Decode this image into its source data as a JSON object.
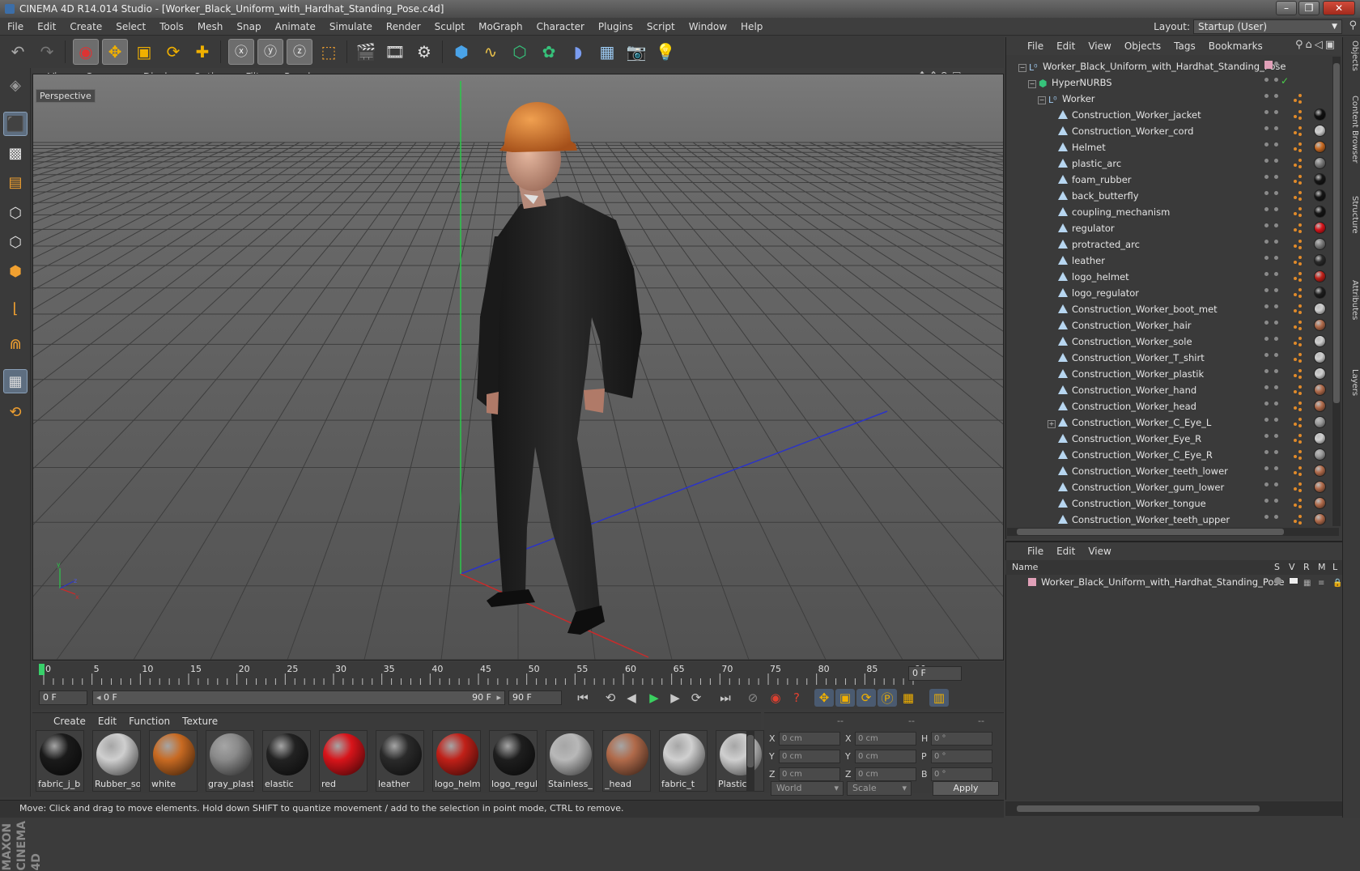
{
  "window": {
    "title": "CINEMA 4D R14.014 Studio - [Worker_Black_Uniform_with_Hardhat_Standing_Pose.c4d]"
  },
  "menu": [
    "File",
    "Edit",
    "Create",
    "Select",
    "Tools",
    "Mesh",
    "Snap",
    "Animate",
    "Simulate",
    "Render",
    "Sculpt",
    "MoGraph",
    "Character",
    "Plugins",
    "Script",
    "Window",
    "Help"
  ],
  "layout": {
    "label": "Layout:",
    "value": "Startup (User)"
  },
  "viewport": {
    "menu": [
      "View",
      "Cameras",
      "Display",
      "Options",
      "Filter",
      "Panel"
    ],
    "label": "Perspective"
  },
  "timeline": {
    "ticks": [
      "0",
      "5",
      "10",
      "15",
      "20",
      "25",
      "30",
      "35",
      "40",
      "45",
      "50",
      "55",
      "60",
      "65",
      "70",
      "75",
      "80",
      "85",
      "90"
    ],
    "frame_display": "0 F",
    "start": "0 F",
    "range_start": "0 F",
    "range_end": "90 F",
    "end": "90 F"
  },
  "materials": {
    "menu": [
      "Create",
      "Edit",
      "Function",
      "Texture"
    ],
    "items": [
      {
        "name": "fabric_j_b",
        "color": "#1a1a1a"
      },
      {
        "name": "Rubber_so",
        "color": "#cfcfcf"
      },
      {
        "name": "white",
        "color": "#c86a22"
      },
      {
        "name": "gray_plasti",
        "color": "#8a8a8a"
      },
      {
        "name": "elastic",
        "color": "#222222"
      },
      {
        "name": "red",
        "color": "#d8141a"
      },
      {
        "name": "leather",
        "color": "#2a2a2a"
      },
      {
        "name": "logo_helm",
        "color": "#c02018"
      },
      {
        "name": "logo_regul",
        "color": "#1e1e1e"
      },
      {
        "name": "Stainless_",
        "color": "#b8b8b8"
      },
      {
        "name": "_head",
        "color": "#b06a4a"
      },
      {
        "name": "fabric_t",
        "color": "#d0d0d0"
      },
      {
        "name": "Plastic",
        "color": "#cfcfcf"
      }
    ]
  },
  "coords": {
    "headers": [
      "--",
      "--",
      "--"
    ],
    "rows": [
      {
        "a": "X",
        "av": "0 cm",
        "b": "X",
        "bv": "0 cm",
        "c": "H",
        "cv": "0 °"
      },
      {
        "a": "Y",
        "av": "0 cm",
        "b": "Y",
        "bv": "0 cm",
        "c": "P",
        "cv": "0 °"
      },
      {
        "a": "Z",
        "av": "0 cm",
        "b": "Z",
        "bv": "0 cm",
        "c": "B",
        "cv": "0 °"
      }
    ],
    "mode": "World",
    "transform": "Scale",
    "apply": "Apply"
  },
  "status": "Move: Click and drag to move elements. Hold down SHIFT to quantize movement / add to the selection in point mode, CTRL to remove.",
  "objects": {
    "menu": [
      "File",
      "Edit",
      "View",
      "Objects",
      "Tags",
      "Bookmarks"
    ],
    "items": [
      {
        "name": "Worker_Black_Uniform_with_Hardhat_Standing_Pose",
        "depth": 0,
        "icon": "null",
        "ball": ""
      },
      {
        "name": "HyperNURBS",
        "depth": 1,
        "icon": "nurbs",
        "ball": ""
      },
      {
        "name": "Worker",
        "depth": 2,
        "icon": "null",
        "ball": ""
      },
      {
        "name": "Construction_Worker_jacket",
        "depth": 3,
        "icon": "poly",
        "ball": "#111111"
      },
      {
        "name": "Construction_Worker_cord",
        "depth": 3,
        "icon": "poly",
        "ball": "#cfcfcf"
      },
      {
        "name": "Helmet",
        "depth": 3,
        "icon": "poly",
        "ball": "#c86a22"
      },
      {
        "name": "plastic_arc",
        "depth": 3,
        "icon": "poly",
        "ball": "#7a7a7a"
      },
      {
        "name": "foam_rubber",
        "depth": 3,
        "icon": "poly",
        "ball": "#151515"
      },
      {
        "name": "back_butterfly",
        "depth": 3,
        "icon": "poly",
        "ball": "#151515"
      },
      {
        "name": "coupling_mechanism",
        "depth": 3,
        "icon": "poly",
        "ball": "#151515"
      },
      {
        "name": "regulator",
        "depth": 3,
        "icon": "poly",
        "ball": "#d8141a"
      },
      {
        "name": "protracted_arc",
        "depth": 3,
        "icon": "poly",
        "ball": "#7a7a7a"
      },
      {
        "name": "leather",
        "depth": 3,
        "icon": "poly",
        "ball": "#2a2a2a"
      },
      {
        "name": "logo_helmet",
        "depth": 3,
        "icon": "poly",
        "ball": "#c02018"
      },
      {
        "name": "logo_regulator",
        "depth": 3,
        "icon": "poly",
        "ball": "#1e1e1e"
      },
      {
        "name": "Construction_Worker_boot_met",
        "depth": 3,
        "icon": "poly",
        "ball": "#d0d0d0"
      },
      {
        "name": "Construction_Worker_hair",
        "depth": 3,
        "icon": "poly",
        "ball": "#b06a4a"
      },
      {
        "name": "Construction_Worker_sole",
        "depth": 3,
        "icon": "poly",
        "ball": "#cfcfcf"
      },
      {
        "name": "Construction_Worker_T_shirt",
        "depth": 3,
        "icon": "poly",
        "ball": "#cfcfcf"
      },
      {
        "name": "Construction_Worker_plastik",
        "depth": 3,
        "icon": "poly",
        "ball": "#cfcfcf"
      },
      {
        "name": "Construction_Worker_hand",
        "depth": 3,
        "icon": "poly",
        "ball": "#b06a4a"
      },
      {
        "name": "Construction_Worker_head",
        "depth": 3,
        "icon": "poly",
        "ball": "#b06a4a"
      },
      {
        "name": "Construction_Worker_C_Eye_L",
        "depth": 3,
        "icon": "poly",
        "ball": "#9a9a9a"
      },
      {
        "name": "Construction_Worker_Eye_R",
        "depth": 3,
        "icon": "poly",
        "ball": "#d0d0d0"
      },
      {
        "name": "Construction_Worker_C_Eye_R",
        "depth": 3,
        "icon": "poly",
        "ball": "#9a9a9a"
      },
      {
        "name": "Construction_Worker_teeth_lower",
        "depth": 3,
        "icon": "poly",
        "ball": "#b06a4a"
      },
      {
        "name": "Construction_Worker_gum_lower",
        "depth": 3,
        "icon": "poly",
        "ball": "#b06a4a"
      },
      {
        "name": "Construction_Worker_tongue",
        "depth": 3,
        "icon": "poly",
        "ball": "#b06a4a"
      },
      {
        "name": "Construction_Worker_teeth_upper",
        "depth": 3,
        "icon": "poly",
        "ball": "#b06a4a"
      }
    ]
  },
  "sidetabs": [
    "Objects",
    "Content Browser",
    "Structure",
    "Attributes",
    "Layers"
  ],
  "layers": {
    "menu": [
      "File",
      "Edit",
      "View"
    ],
    "columns": {
      "name": "Name",
      "s": "S",
      "v": "V",
      "r": "R",
      "m": "M",
      "l": "L"
    },
    "row": "Worker_Black_Uniform_with_Hardhat_Standing_Pose"
  },
  "brand": "MAXON CINEMA 4D"
}
